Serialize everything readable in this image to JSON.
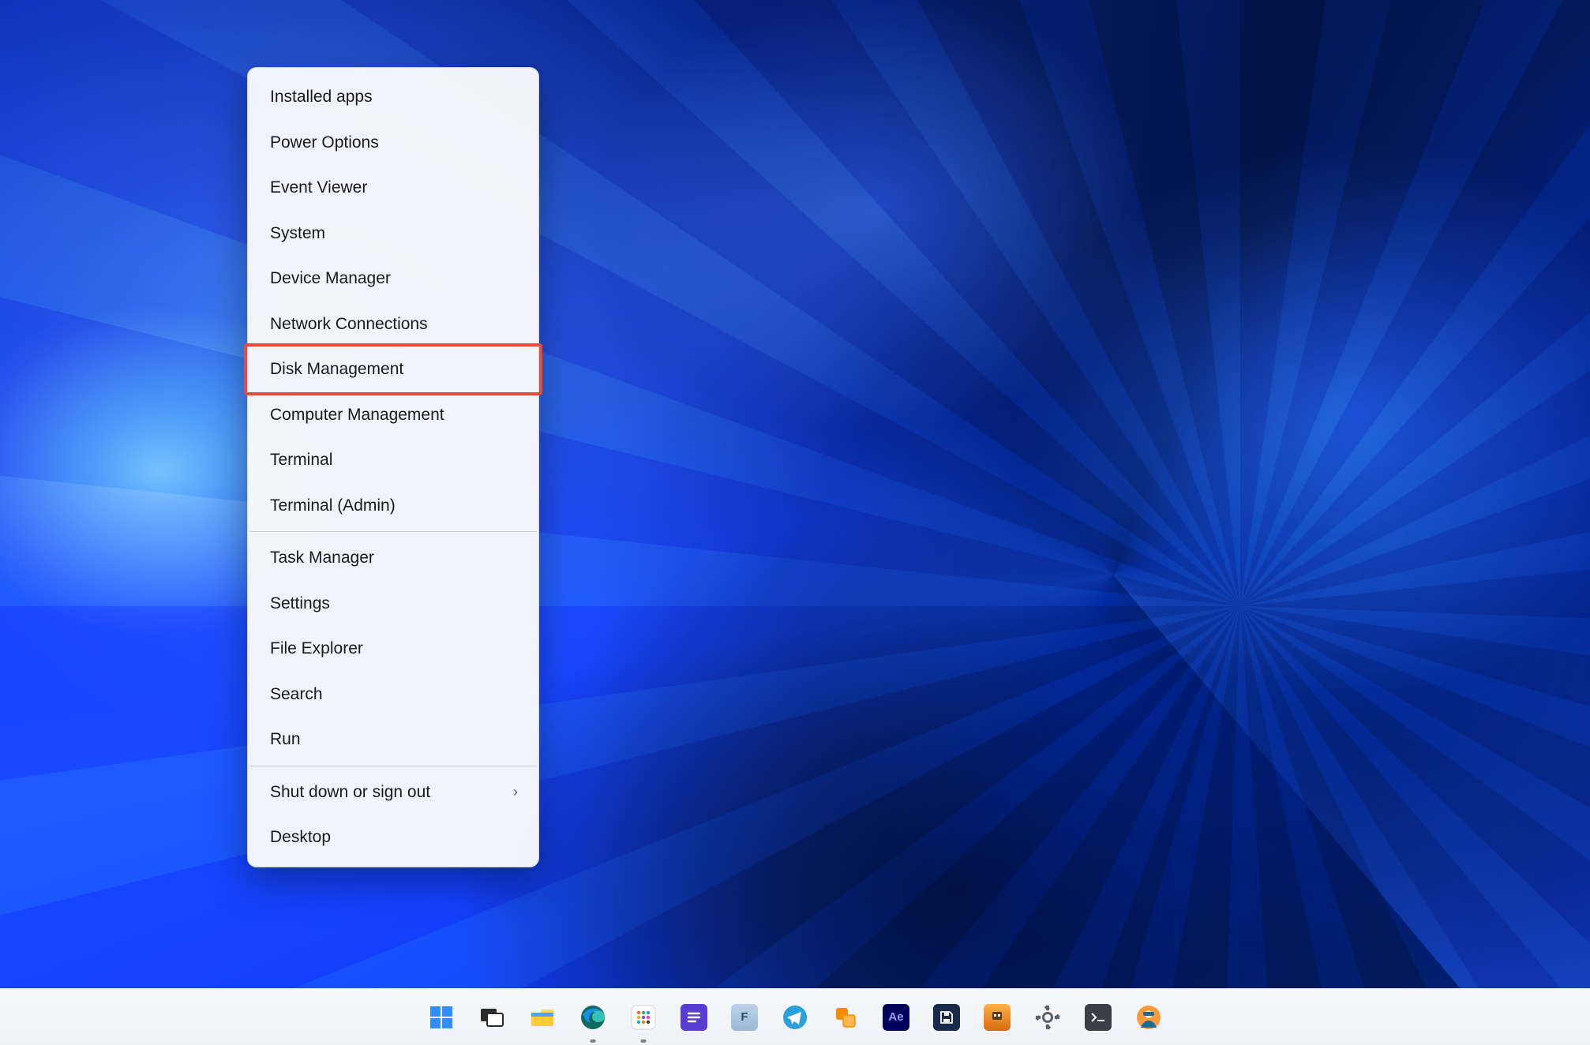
{
  "menu": {
    "groups": [
      [
        {
          "id": "installed-apps",
          "label": "Installed apps",
          "submenu": false
        },
        {
          "id": "power-options",
          "label": "Power Options",
          "submenu": false
        },
        {
          "id": "event-viewer",
          "label": "Event Viewer",
          "submenu": false
        },
        {
          "id": "system",
          "label": "System",
          "submenu": false
        },
        {
          "id": "device-manager",
          "label": "Device Manager",
          "submenu": false
        },
        {
          "id": "network-connections",
          "label": "Network Connections",
          "submenu": false
        },
        {
          "id": "disk-management",
          "label": "Disk Management",
          "submenu": false,
          "highlighted": true
        },
        {
          "id": "computer-management",
          "label": "Computer Management",
          "submenu": false
        },
        {
          "id": "terminal",
          "label": "Terminal",
          "submenu": false
        },
        {
          "id": "terminal-admin",
          "label": "Terminal (Admin)",
          "submenu": false
        }
      ],
      [
        {
          "id": "task-manager",
          "label": "Task Manager",
          "submenu": false
        },
        {
          "id": "settings",
          "label": "Settings",
          "submenu": false
        },
        {
          "id": "file-explorer",
          "label": "File Explorer",
          "submenu": false
        },
        {
          "id": "search",
          "label": "Search",
          "submenu": false
        },
        {
          "id": "run",
          "label": "Run",
          "submenu": false
        }
      ],
      [
        {
          "id": "shut-down-or-sign-out",
          "label": "Shut down or sign out",
          "submenu": true
        },
        {
          "id": "desktop",
          "label": "Desktop",
          "submenu": false
        }
      ]
    ]
  },
  "taskbar": {
    "items": [
      {
        "id": "start",
        "name": "Start",
        "running": false
      },
      {
        "id": "task-view",
        "name": "Task View",
        "running": false
      },
      {
        "id": "file-explorer",
        "name": "File Explorer",
        "running": false
      },
      {
        "id": "edge",
        "name": "Microsoft Edge",
        "running": true
      },
      {
        "id": "app-grid",
        "name": "App (colorful grid)",
        "running": true
      },
      {
        "id": "app-purple",
        "name": "App (purple lines)",
        "running": false
      },
      {
        "id": "app-f",
        "name": "App (F logo)",
        "running": false
      },
      {
        "id": "telegram",
        "name": "Telegram",
        "running": false
      },
      {
        "id": "app-orange",
        "name": "App (orange squares)",
        "running": false
      },
      {
        "id": "after-effects",
        "name": "Adobe After Effects",
        "running": false
      },
      {
        "id": "app-save",
        "name": "App (save/disk)",
        "running": false
      },
      {
        "id": "avatar-app",
        "name": "Game/App (avatar)",
        "running": false
      },
      {
        "id": "settings",
        "name": "Settings",
        "running": false
      },
      {
        "id": "terminal",
        "name": "Terminal",
        "running": false
      },
      {
        "id": "user-avatar",
        "name": "User avatar",
        "running": false
      }
    ]
  },
  "colors": {
    "highlight_border": "#e84b3c",
    "menu_bg": "rgba(248,248,252,0.97)",
    "taskbar_bg_top": "#f6f8fb",
    "taskbar_bg_bottom": "#eef1f6"
  }
}
